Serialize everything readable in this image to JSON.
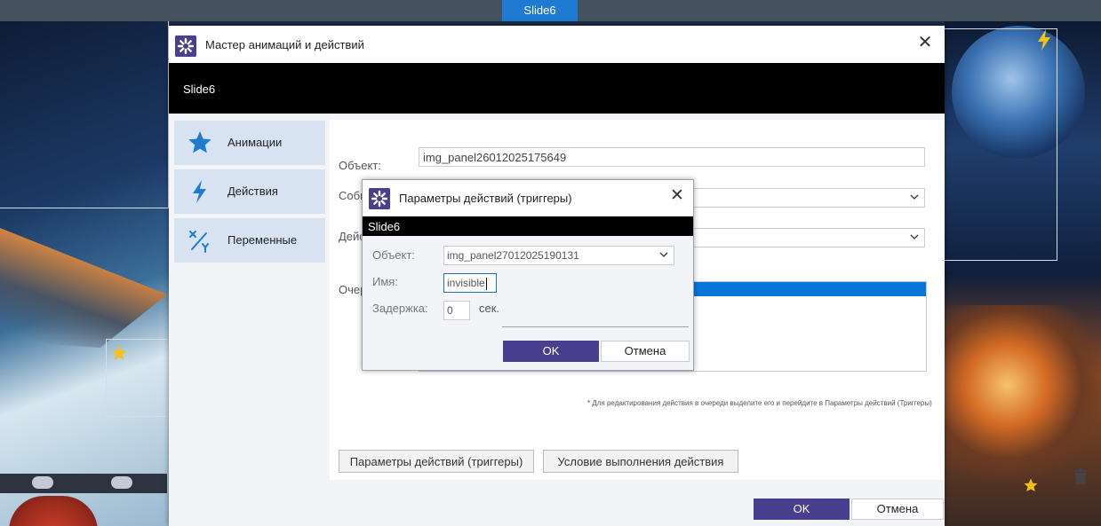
{
  "editor": {
    "slide_tab": "Slide6"
  },
  "dialog": {
    "title": "Мастер анимаций и действий",
    "banner": "Slide6",
    "sidebar": {
      "items": [
        {
          "label": "Анимации",
          "icon": "star-icon"
        },
        {
          "label": "Действия",
          "icon": "lightning-icon"
        },
        {
          "label": "Переменные",
          "icon": "variables-icon"
        }
      ]
    },
    "form": {
      "object_label": "Объект:",
      "object_value": "img_panel26012025175649",
      "event_label": "Собы",
      "action_label": "Дейс",
      "queue_label": "Очер"
    },
    "note": "* Для редактирования действия в очереди выделите его и перейдите в Параметры действий (Триггеры)",
    "buttons": {
      "trigger_params": "Параметры действий (триггеры)",
      "execution_condition": "Условие выполнения действия",
      "ok": "OK",
      "cancel": "Отмена"
    }
  },
  "trigger_dialog": {
    "title": "Параметры действий (триггеры)",
    "banner": "Slide6",
    "object_label": "Объект:",
    "object_value": "img_panel27012025190131",
    "name_label": "Имя:",
    "name_value": "invisible",
    "delay_label": "Задержка:",
    "delay_value": "0",
    "delay_unit": "сек.",
    "ok": "OK",
    "cancel": "Отмена"
  },
  "colors": {
    "accent": "#4a3f8f",
    "selection": "#0a74d9",
    "sidebar_bg": "#d7e3f1",
    "tab_blue": "#1f7ad1"
  }
}
